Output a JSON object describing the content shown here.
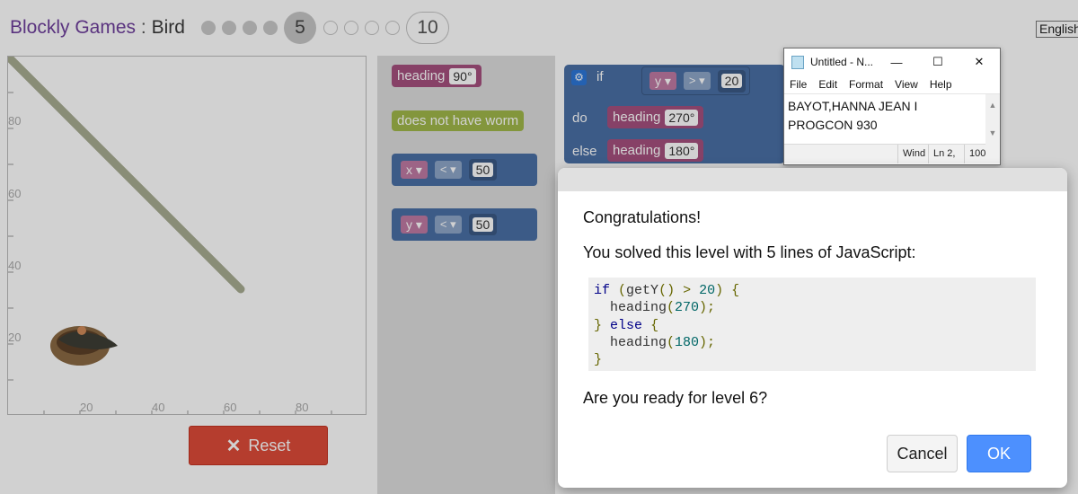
{
  "header": {
    "app_name": "Blockly Games",
    "separator": " : ",
    "game_name": "Bird",
    "levels": {
      "completed_dots": 4,
      "current": "5",
      "remaining_dots": 4,
      "last": "10"
    },
    "language": "English"
  },
  "viz": {
    "y_ticks": [
      "80",
      "60",
      "40",
      "20"
    ],
    "x_ticks": [
      "20",
      "40",
      "60",
      "80"
    ]
  },
  "reset": {
    "label": "Reset"
  },
  "toolbox": {
    "heading_label": "heading",
    "heading_value": "90°",
    "worm_label": "does not have worm",
    "x_compare": {
      "var": "x",
      "op": "<",
      "value": "50"
    },
    "y_compare": {
      "var": "y",
      "op": "<",
      "value": "50"
    }
  },
  "workspace": {
    "if_label": "if",
    "do_label": "do",
    "else_label": "else",
    "condition": {
      "var": "y",
      "op": ">",
      "value": "20"
    },
    "do_heading_label": "heading",
    "do_heading_value": "270°",
    "else_heading_label": "heading",
    "else_heading_value": "180°"
  },
  "notepad": {
    "title": "Untitled - N...",
    "menu": [
      "File",
      "Edit",
      "Format",
      "View",
      "Help"
    ],
    "line1": "BAYOT,HANNA JEAN I",
    "line2": "PROGCON 930",
    "status_wind": "Wind",
    "status_ln": "Ln 2,",
    "status_zoom": "100"
  },
  "dialog": {
    "congrats": "Congratulations!",
    "solved": "You solved this level with 5 lines of JavaScript:",
    "ready": "Are you ready for level 6?",
    "cancel": "Cancel",
    "ok": "OK"
  },
  "colors": {
    "title_link": "#6e3f9c",
    "reset_button": "#dd4b39",
    "heading_block": "#a5507e",
    "worm_block": "#a0b84a",
    "logic_block": "#4a6fa5",
    "ok_button": "#4d90fe"
  },
  "icons": {
    "reset": "close-x-icon",
    "gear": "gear-icon",
    "notepad": "notepad-icon",
    "nest": "nest-icon"
  }
}
